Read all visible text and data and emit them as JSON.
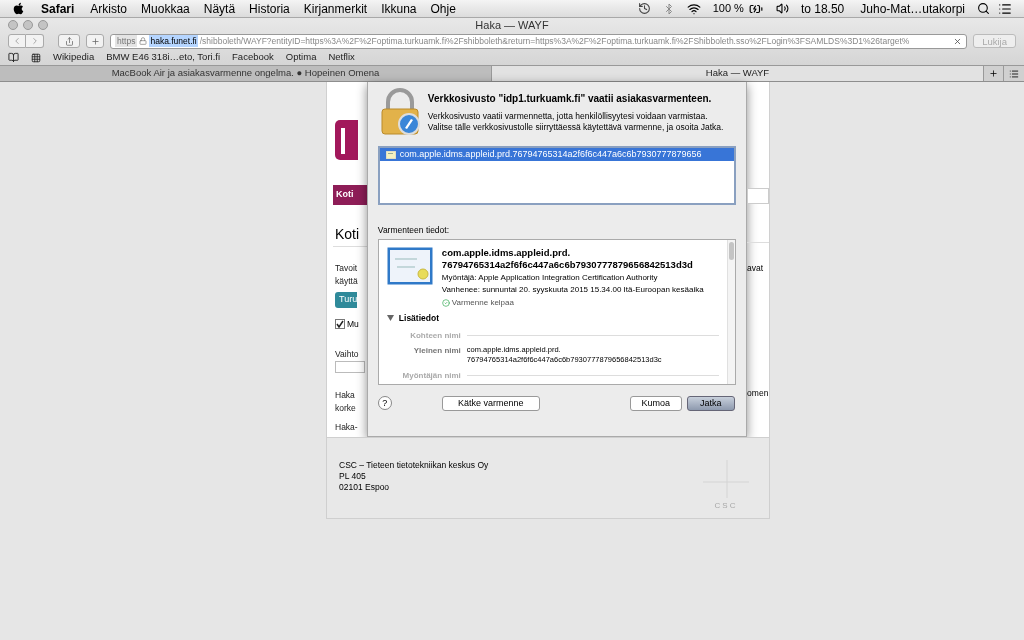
{
  "menu_bar": {
    "app": "Safari",
    "menus": [
      "Arkisto",
      "Muokkaa",
      "Näytä",
      "Historia",
      "Kirjanmerkit",
      "Ikkuna",
      "Ohje"
    ],
    "battery": "100 %",
    "clock": "to 18.50",
    "user": "Juho-Mat…utakorpi"
  },
  "window": {
    "title": "Haka — WAYF"
  },
  "toolbar": {
    "url": {
      "scheme": "https",
      "host": "haka.funet.fi",
      "path": "/shibboleth/WAYF?entityID=https%3A%2F%2Foptima.turkuamk.fi%2Fshibboleth&return=https%3A%2F%2Foptima.turkuamk.fi%2FShibboleth.sso%2FLogin%3FSAMLDS%3D1%26target%"
    },
    "reader": "Lukija"
  },
  "bookmarks": [
    "Wikipedia",
    "BMW E46 318i…eto, Tori.fi",
    "Facebook",
    "Optima",
    "Netflix"
  ],
  "tabs": [
    {
      "label": "MacBook Air ja asiakasvarmenne ongelma. ● Hopeinen Omena",
      "selected": false
    },
    {
      "label": "Haka — WAYF",
      "selected": true
    }
  ],
  "page": {
    "nav_tab": "Koti",
    "heading": "Koti",
    "rows": [
      {
        "kind": "text",
        "left": "Tavoit",
        "right": "avat"
      },
      {
        "kind": "text",
        "left": "käyttä"
      },
      {
        "kind": "button",
        "left": "Turu"
      },
      {
        "kind": "checkbox",
        "left": "Mu",
        "checked": true
      },
      {
        "kind": "text",
        "left": "Vaihto"
      },
      {
        "kind": "field"
      },
      {
        "kind": "text",
        "left": "Haka",
        "right": "omen"
      },
      {
        "kind": "text",
        "left": "korke"
      },
      {
        "kind": "text",
        "left": "Haka-"
      }
    ],
    "footer": [
      "CSC – Tieteen tietotekniikan keskus Oy",
      "PL 405",
      "02101 Espoo"
    ],
    "footer_logo": "CSC"
  },
  "dialog": {
    "title": "Verkkosivusto \"idp1.turkuamk.fi\" vaatii asiakasvarmenteen.",
    "message": "Verkkosivusto vaatii varmennetta, jotta henkilöllisyytesi voidaan varmistaa. Valitse tälle verkkosivustolle siirryttäessä käytettävä varmenne, ja osoita Jatka.",
    "certificates": [
      {
        "name": "com.apple.idms.appleid.prd.76794765314a2f6f6c447a6c6b7930777879656",
        "selected": true
      }
    ],
    "details_label": "Varmenteen tiedot:",
    "details": {
      "name": [
        "com.apple.idms.appleid.prd.",
        "76794765314a2f6f6c447a6c6b7930777879656842513d3d"
      ],
      "issuer": "Myöntäjä: Apple Application Integration Certification Authority",
      "expires": "Vanhenee: sunnuntai 20. syyskuuta 2015 15.34.00 Itä-Euroopan kesäaika",
      "valid": "Varmenne kelpaa",
      "more": {
        "label": "Lisätiedot",
        "expanded": true,
        "sections": [
          {
            "kind": "header",
            "label": "Kohteen nimi"
          },
          {
            "kind": "field",
            "label": "Yleinen nimi",
            "value": [
              "com.apple.idms.appleid.prd.",
              "76794765314a2f6f6c447a6c6b7930777879656842513d3c"
            ]
          },
          {
            "kind": "header",
            "label": "Myöntäjän nimi"
          }
        ]
      }
    },
    "help": "?",
    "buttons": [
      {
        "label": "Kätke varmenne",
        "kind": "normal"
      },
      {
        "label": "Kumoa",
        "kind": "normal"
      },
      {
        "label": "Jatka",
        "kind": "default"
      }
    ]
  }
}
